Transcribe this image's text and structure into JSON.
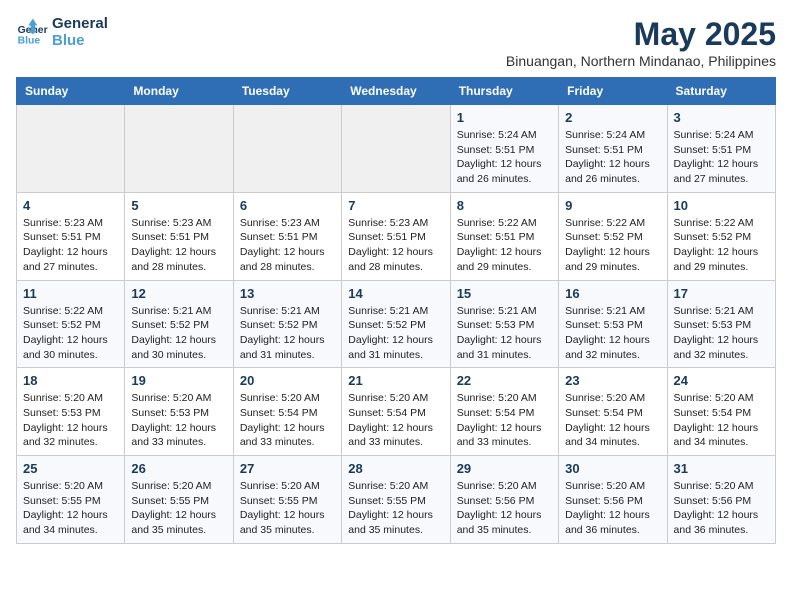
{
  "header": {
    "logo_line1": "General",
    "logo_line2": "Blue",
    "month": "May 2025",
    "location": "Binuangan, Northern Mindanao, Philippines"
  },
  "weekdays": [
    "Sunday",
    "Monday",
    "Tuesday",
    "Wednesday",
    "Thursday",
    "Friday",
    "Saturday"
  ],
  "weeks": [
    [
      {
        "day": "",
        "info": ""
      },
      {
        "day": "",
        "info": ""
      },
      {
        "day": "",
        "info": ""
      },
      {
        "day": "",
        "info": ""
      },
      {
        "day": "1",
        "info": "Sunrise: 5:24 AM\nSunset: 5:51 PM\nDaylight: 12 hours\nand 26 minutes."
      },
      {
        "day": "2",
        "info": "Sunrise: 5:24 AM\nSunset: 5:51 PM\nDaylight: 12 hours\nand 26 minutes."
      },
      {
        "day": "3",
        "info": "Sunrise: 5:24 AM\nSunset: 5:51 PM\nDaylight: 12 hours\nand 27 minutes."
      }
    ],
    [
      {
        "day": "4",
        "info": "Sunrise: 5:23 AM\nSunset: 5:51 PM\nDaylight: 12 hours\nand 27 minutes."
      },
      {
        "day": "5",
        "info": "Sunrise: 5:23 AM\nSunset: 5:51 PM\nDaylight: 12 hours\nand 28 minutes."
      },
      {
        "day": "6",
        "info": "Sunrise: 5:23 AM\nSunset: 5:51 PM\nDaylight: 12 hours\nand 28 minutes."
      },
      {
        "day": "7",
        "info": "Sunrise: 5:23 AM\nSunset: 5:51 PM\nDaylight: 12 hours\nand 28 minutes."
      },
      {
        "day": "8",
        "info": "Sunrise: 5:22 AM\nSunset: 5:51 PM\nDaylight: 12 hours\nand 29 minutes."
      },
      {
        "day": "9",
        "info": "Sunrise: 5:22 AM\nSunset: 5:52 PM\nDaylight: 12 hours\nand 29 minutes."
      },
      {
        "day": "10",
        "info": "Sunrise: 5:22 AM\nSunset: 5:52 PM\nDaylight: 12 hours\nand 29 minutes."
      }
    ],
    [
      {
        "day": "11",
        "info": "Sunrise: 5:22 AM\nSunset: 5:52 PM\nDaylight: 12 hours\nand 30 minutes."
      },
      {
        "day": "12",
        "info": "Sunrise: 5:21 AM\nSunset: 5:52 PM\nDaylight: 12 hours\nand 30 minutes."
      },
      {
        "day": "13",
        "info": "Sunrise: 5:21 AM\nSunset: 5:52 PM\nDaylight: 12 hours\nand 31 minutes."
      },
      {
        "day": "14",
        "info": "Sunrise: 5:21 AM\nSunset: 5:52 PM\nDaylight: 12 hours\nand 31 minutes."
      },
      {
        "day": "15",
        "info": "Sunrise: 5:21 AM\nSunset: 5:53 PM\nDaylight: 12 hours\nand 31 minutes."
      },
      {
        "day": "16",
        "info": "Sunrise: 5:21 AM\nSunset: 5:53 PM\nDaylight: 12 hours\nand 32 minutes."
      },
      {
        "day": "17",
        "info": "Sunrise: 5:21 AM\nSunset: 5:53 PM\nDaylight: 12 hours\nand 32 minutes."
      }
    ],
    [
      {
        "day": "18",
        "info": "Sunrise: 5:20 AM\nSunset: 5:53 PM\nDaylight: 12 hours\nand 32 minutes."
      },
      {
        "day": "19",
        "info": "Sunrise: 5:20 AM\nSunset: 5:53 PM\nDaylight: 12 hours\nand 33 minutes."
      },
      {
        "day": "20",
        "info": "Sunrise: 5:20 AM\nSunset: 5:54 PM\nDaylight: 12 hours\nand 33 minutes."
      },
      {
        "day": "21",
        "info": "Sunrise: 5:20 AM\nSunset: 5:54 PM\nDaylight: 12 hours\nand 33 minutes."
      },
      {
        "day": "22",
        "info": "Sunrise: 5:20 AM\nSunset: 5:54 PM\nDaylight: 12 hours\nand 33 minutes."
      },
      {
        "day": "23",
        "info": "Sunrise: 5:20 AM\nSunset: 5:54 PM\nDaylight: 12 hours\nand 34 minutes."
      },
      {
        "day": "24",
        "info": "Sunrise: 5:20 AM\nSunset: 5:54 PM\nDaylight: 12 hours\nand 34 minutes."
      }
    ],
    [
      {
        "day": "25",
        "info": "Sunrise: 5:20 AM\nSunset: 5:55 PM\nDaylight: 12 hours\nand 34 minutes."
      },
      {
        "day": "26",
        "info": "Sunrise: 5:20 AM\nSunset: 5:55 PM\nDaylight: 12 hours\nand 35 minutes."
      },
      {
        "day": "27",
        "info": "Sunrise: 5:20 AM\nSunset: 5:55 PM\nDaylight: 12 hours\nand 35 minutes."
      },
      {
        "day": "28",
        "info": "Sunrise: 5:20 AM\nSunset: 5:55 PM\nDaylight: 12 hours\nand 35 minutes."
      },
      {
        "day": "29",
        "info": "Sunrise: 5:20 AM\nSunset: 5:56 PM\nDaylight: 12 hours\nand 35 minutes."
      },
      {
        "day": "30",
        "info": "Sunrise: 5:20 AM\nSunset: 5:56 PM\nDaylight: 12 hours\nand 36 minutes."
      },
      {
        "day": "31",
        "info": "Sunrise: 5:20 AM\nSunset: 5:56 PM\nDaylight: 12 hours\nand 36 minutes."
      }
    ]
  ]
}
